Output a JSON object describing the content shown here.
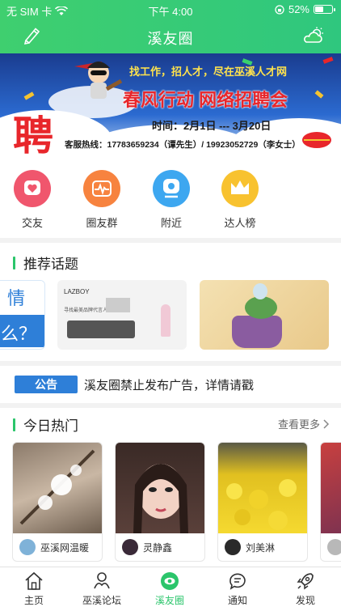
{
  "status_bar": {
    "carrier": "无 SIM 卡",
    "time": "下午 4:00",
    "battery": "52%",
    "battery_level": 0.52
  },
  "navbar": {
    "title": "溪友圈"
  },
  "banner": {
    "line1": "找工作，招人才，尽在巫溪人才网",
    "line2": "春风行动  网络招聘会",
    "line3": "时间：2月1日 --- 3月20日",
    "line4": "客服热线：17783659234（谭先生）/ 19923052729（李女士）",
    "big_char": "聘"
  },
  "quick_entries": [
    {
      "label": "交友",
      "color": "#f0566d",
      "icon": "heart-icon"
    },
    {
      "label": "圈友群",
      "color": "#f7833f",
      "icon": "pulse-icon"
    },
    {
      "label": "附近",
      "color": "#3da7f0",
      "icon": "location-icon"
    },
    {
      "label": "达人榜",
      "color": "#f8c22f",
      "icon": "crown-icon"
    }
  ],
  "topics": {
    "title": "推荐话题",
    "card1_text_a": "情",
    "card1_text_b": "么？",
    "card2_brand": "LAZBOY",
    "card2_slogan": "寻找最美品牌代言人"
  },
  "notice": {
    "tag": "公告",
    "text": "溪友圈禁止发布广告，详情请戳"
  },
  "hot": {
    "title": "今日热门",
    "more": "查看更多",
    "items": [
      {
        "user": "巫溪网温暖"
      },
      {
        "user": "灵静鑫"
      },
      {
        "user": "刘美淋"
      }
    ]
  },
  "tabbar": {
    "items": [
      {
        "label": "主页"
      },
      {
        "label": "巫溪论坛"
      },
      {
        "label": "溪友圈"
      },
      {
        "label": "通知"
      },
      {
        "label": "发现"
      }
    ]
  },
  "colors": {
    "accent": "#2bc56b",
    "header": "#3fcf6f",
    "notice_tag": "#2e7fd8"
  }
}
